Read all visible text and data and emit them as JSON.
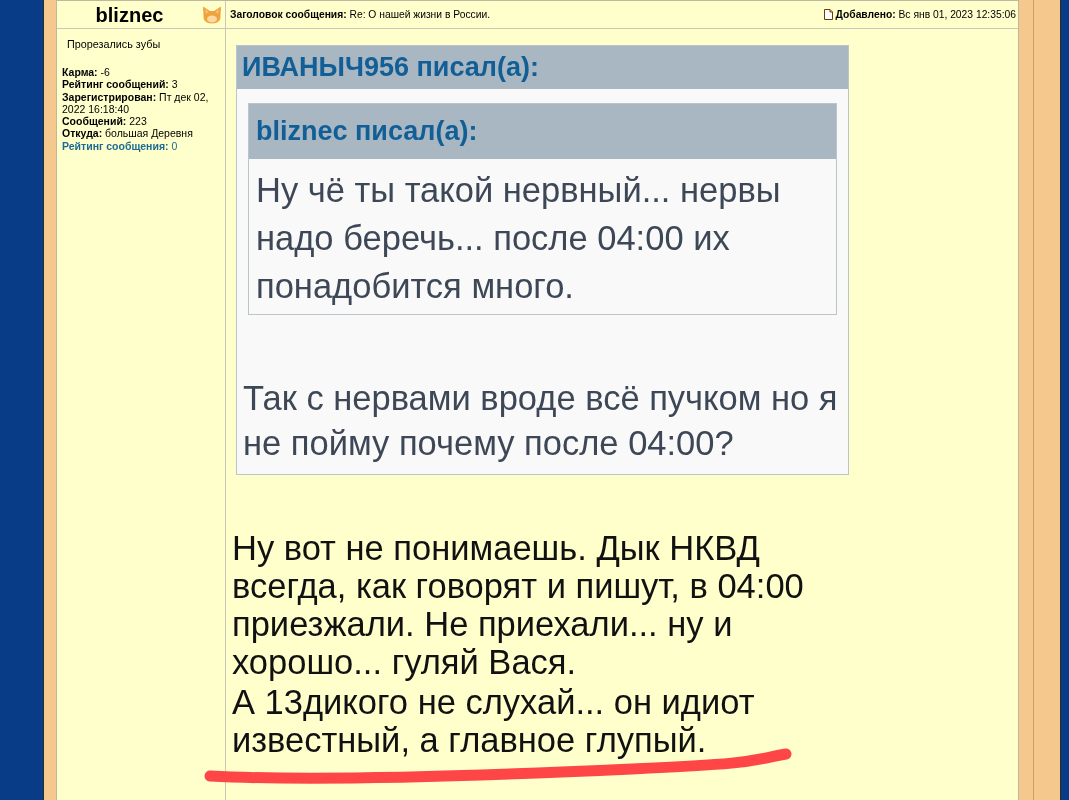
{
  "post": {
    "author": "bliznec",
    "subject_label": "Заголовок сообщения:",
    "subject": "Re: О нашей жизни в России.",
    "posted_label": "Добавлено:",
    "posted": "Вс янв 01, 2023 12:35:06"
  },
  "profile": {
    "rank": "Прорезались зубы",
    "fields": [
      {
        "kind": "info",
        "label": "Карма:",
        "value": "-6"
      },
      {
        "kind": "info",
        "label": "Рейтинг сообщений:",
        "value": "3"
      },
      {
        "kind": "info",
        "label": "Зарегистрирован:",
        "value": "Пт дек 02, 2022 16:18:40"
      },
      {
        "kind": "info",
        "label": "Сообщений:",
        "value": "223"
      },
      {
        "kind": "info",
        "label": "Откуда:",
        "value": "большая Деревня"
      },
      {
        "kind": "rating",
        "label": "Рейтинг сообщения:",
        "value": "0"
      }
    ]
  },
  "quote": {
    "title": "ИВАНЫЧ956 писал(а):",
    "nested_quote": {
      "title": "bliznec писал(а):",
      "text": "Ну чё ты такой нервный... нервы надо беречь... после 04:00 их понадобится много."
    },
    "text": "Так с нервами вроде всё пучком но я не пойму почему после 04:00?"
  },
  "reply": [
    "Ну вот не понимаешь. Дык НКВД всегда, как говорят и пишут, в 04:00 приезжали. Не приехали... ну и хорошо... гуляй Вася.",
    "А 13дикого не слухай... он идиот известный, а главное глупый."
  ]
}
